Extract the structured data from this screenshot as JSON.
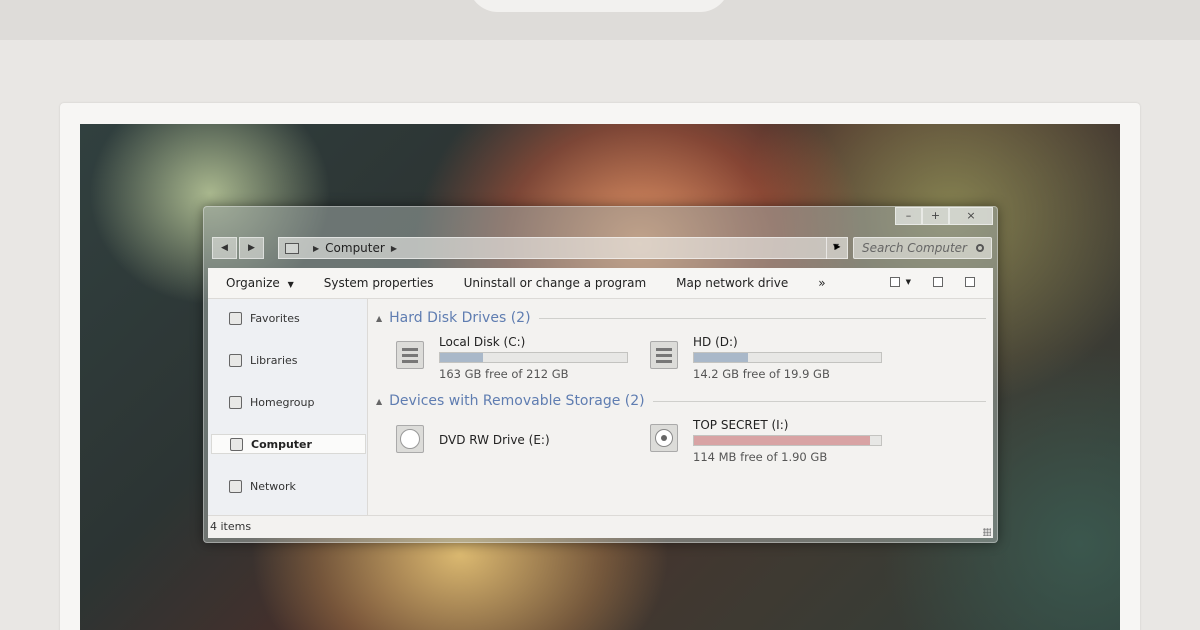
{
  "colors": {
    "group_header": "#5f7db1",
    "bar_normal": "#a9b8c9",
    "bar_full": "#d8a3a4"
  },
  "window": {
    "caption": {
      "minimize": "–",
      "maximize": "+",
      "close": "×"
    }
  },
  "address": {
    "back_icon": "back-arrow-icon",
    "forward_icon": "forward-arrow-icon",
    "location": "Computer",
    "search_placeholder": "Search Computer"
  },
  "toolbar": {
    "organize": "Organize",
    "system_properties": "System properties",
    "uninstall": "Uninstall or change a program",
    "map_drive": "Map network drive",
    "more": "»"
  },
  "sidebar": {
    "items": [
      {
        "label": "Favorites",
        "icon": "star-icon",
        "selected": false
      },
      {
        "label": "Libraries",
        "icon": "library-icon",
        "selected": false
      },
      {
        "label": "Homegroup",
        "icon": "homegroup-icon",
        "selected": false
      },
      {
        "label": "Computer",
        "icon": "computer-icon",
        "selected": true
      },
      {
        "label": "Network",
        "icon": "network-icon",
        "selected": false
      }
    ]
  },
  "groups": [
    {
      "title": "Hard Disk Drives (2)",
      "drives": [
        {
          "name": "Local Disk (C:)",
          "free_text": "163 GB free of 212 GB",
          "used_fraction": 0.23,
          "icon": "hard-drive-icon"
        },
        {
          "name": "HD (D:)",
          "free_text": "14.2 GB free of 19.9 GB",
          "used_fraction": 0.29,
          "icon": "hard-drive-icon"
        }
      ]
    },
    {
      "title": "Devices with Removable Storage (2)",
      "drives": [
        {
          "name": "DVD RW Drive (E:)",
          "icon": "dvd-drive-icon"
        },
        {
          "name": "TOP SECRET (I:)",
          "free_text": "114 MB free of 1.90 GB",
          "used_fraction": 0.94,
          "icon": "usb-drive-icon"
        }
      ]
    }
  ],
  "status": {
    "items_text": "4 items"
  }
}
